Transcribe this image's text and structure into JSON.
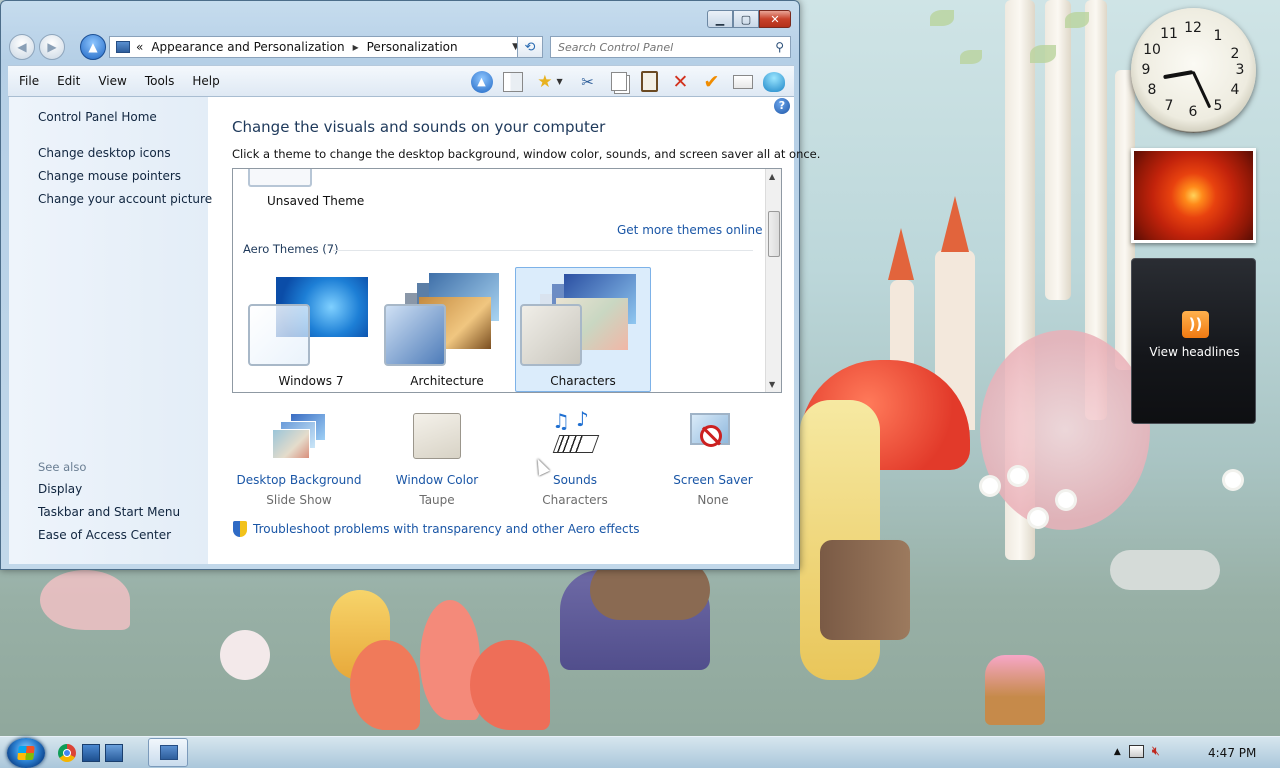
{
  "window": {
    "caption": {
      "minimize": "▁",
      "maximize": "▢",
      "close": "✕"
    },
    "address": {
      "crumbs_prefix": "«",
      "crumb1": "Appearance and Personalization",
      "crumb2": "Personalization",
      "dropdown": "▼"
    },
    "refresh_glyph": "⟲",
    "search": {
      "placeholder": "Search Control Panel",
      "glyph": "⚲"
    },
    "menu": [
      "File",
      "Edit",
      "View",
      "Tools",
      "Help"
    ]
  },
  "left_pane": {
    "home": "Control Panel Home",
    "tasks": [
      "Change desktop icons",
      "Change mouse pointers",
      "Change your account picture"
    ],
    "see_also_heading": "See also",
    "see_also": [
      "Display",
      "Taskbar and Start Menu",
      "Ease of Access Center"
    ]
  },
  "main": {
    "title": "Change the visuals and sounds on your computer",
    "description": "Click a theme to change the desktop background, window color, sounds, and screen saver all at once.",
    "help_glyph": "?",
    "themes": {
      "unsaved_label": "Unsaved Theme",
      "get_more": "Get more themes online",
      "aero_heading": "Aero Themes (7)",
      "items": [
        {
          "label": "Windows 7",
          "selected": false
        },
        {
          "label": "Architecture",
          "selected": false
        },
        {
          "label": "Characters",
          "selected": true
        }
      ]
    },
    "options": [
      {
        "title": "Desktop Background",
        "value": "Slide Show",
        "icon": "desktop-background-icon"
      },
      {
        "title": "Window Color",
        "value": "Taupe",
        "icon": "window-color-icon"
      },
      {
        "title": "Sounds",
        "value": "Characters",
        "icon": "sounds-icon"
      },
      {
        "title": "Screen Saver",
        "value": "None",
        "icon": "screen-saver-icon"
      }
    ],
    "troubleshoot": "Troubleshoot problems with transparency and other Aero effects"
  },
  "gadgets": {
    "clock_numbers": [
      "12",
      "1",
      "2",
      "3",
      "4",
      "5",
      "6",
      "7",
      "8",
      "9",
      "10",
      "11"
    ],
    "feed_label": "View headlines"
  },
  "taskbar": {
    "time": "4:47 PM"
  }
}
